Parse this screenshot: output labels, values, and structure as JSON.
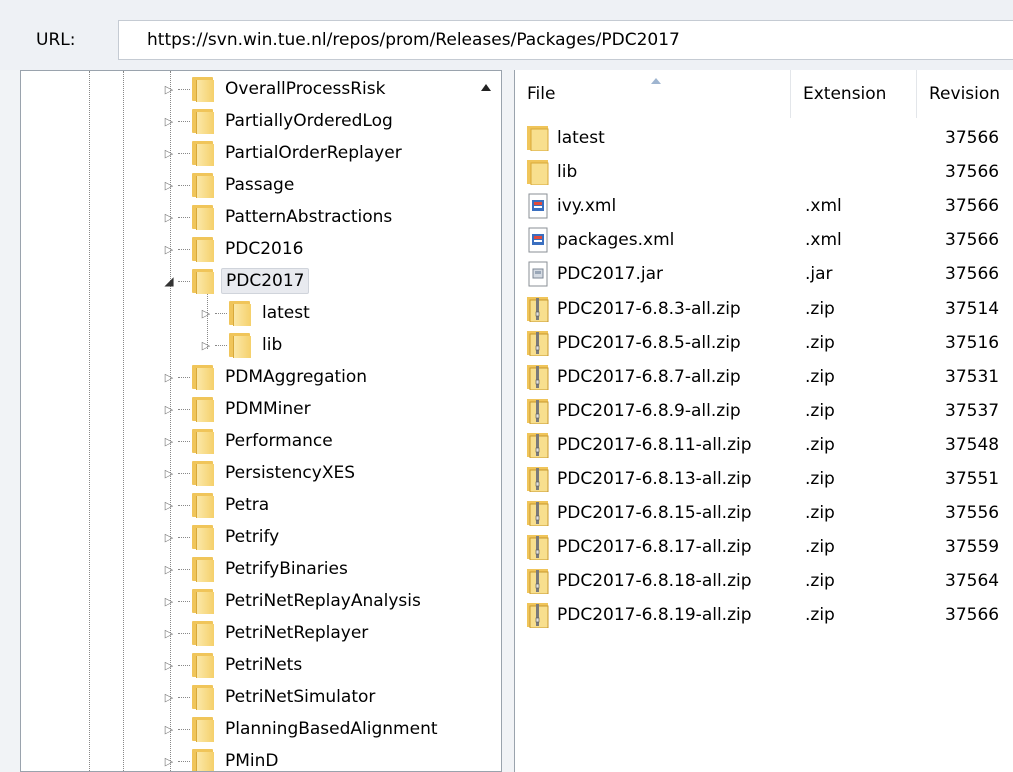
{
  "url_bar": {
    "label": "URL:",
    "value": "https://svn.win.tue.nl/repos/prom/Releases/Packages/PDC2017"
  },
  "tree": {
    "items": [
      {
        "label": "OverallProcessRisk",
        "level": 0,
        "state": "collapsed"
      },
      {
        "label": "PartiallyOrderedLog",
        "level": 0,
        "state": "collapsed"
      },
      {
        "label": "PartialOrderReplayer",
        "level": 0,
        "state": "collapsed"
      },
      {
        "label": "Passage",
        "level": 0,
        "state": "collapsed"
      },
      {
        "label": "PatternAbstractions",
        "level": 0,
        "state": "collapsed"
      },
      {
        "label": "PDC2016",
        "level": 0,
        "state": "collapsed"
      },
      {
        "label": "PDC2017",
        "level": 0,
        "state": "expanded",
        "selected": true
      },
      {
        "label": "latest",
        "level": 1,
        "state": "collapsed"
      },
      {
        "label": "lib",
        "level": 1,
        "state": "collapsed"
      },
      {
        "label": "PDMAggregation",
        "level": 0,
        "state": "collapsed"
      },
      {
        "label": "PDMMiner",
        "level": 0,
        "state": "collapsed"
      },
      {
        "label": "Performance",
        "level": 0,
        "state": "collapsed"
      },
      {
        "label": "PersistencyXES",
        "level": 0,
        "state": "collapsed"
      },
      {
        "label": "Petra",
        "level": 0,
        "state": "collapsed"
      },
      {
        "label": "Petrify",
        "level": 0,
        "state": "collapsed"
      },
      {
        "label": "PetrifyBinaries",
        "level": 0,
        "state": "collapsed"
      },
      {
        "label": "PetriNetReplayAnalysis",
        "level": 0,
        "state": "collapsed"
      },
      {
        "label": "PetriNetReplayer",
        "level": 0,
        "state": "collapsed"
      },
      {
        "label": "PetriNets",
        "level": 0,
        "state": "collapsed"
      },
      {
        "label": "PetriNetSimulator",
        "level": 0,
        "state": "collapsed"
      },
      {
        "label": "PlanningBasedAlignment",
        "level": 0,
        "state": "collapsed"
      },
      {
        "label": "PMinD",
        "level": 0,
        "state": "collapsed"
      }
    ]
  },
  "file_list": {
    "columns": [
      "File",
      "Extension",
      "Revision"
    ],
    "sort_column": "File",
    "rows": [
      {
        "name": "latest",
        "ext": "",
        "rev": "37566",
        "icon": "folder-icon"
      },
      {
        "name": "lib",
        "ext": "",
        "rev": "37566",
        "icon": "folder-icon"
      },
      {
        "name": "ivy.xml",
        "ext": ".xml",
        "rev": "37566",
        "icon": "xml-file-icon"
      },
      {
        "name": "packages.xml",
        "ext": ".xml",
        "rev": "37566",
        "icon": "xml-file-icon"
      },
      {
        "name": "PDC2017.jar",
        "ext": ".jar",
        "rev": "37566",
        "icon": "jar-file-icon"
      },
      {
        "name": "PDC2017-6.8.3-all.zip",
        "ext": ".zip",
        "rev": "37514",
        "icon": "zip-file-icon"
      },
      {
        "name": "PDC2017-6.8.5-all.zip",
        "ext": ".zip",
        "rev": "37516",
        "icon": "zip-file-icon"
      },
      {
        "name": "PDC2017-6.8.7-all.zip",
        "ext": ".zip",
        "rev": "37531",
        "icon": "zip-file-icon"
      },
      {
        "name": "PDC2017-6.8.9-all.zip",
        "ext": ".zip",
        "rev": "37537",
        "icon": "zip-file-icon"
      },
      {
        "name": "PDC2017-6.8.11-all.zip",
        "ext": ".zip",
        "rev": "37548",
        "icon": "zip-file-icon"
      },
      {
        "name": "PDC2017-6.8.13-all.zip",
        "ext": ".zip",
        "rev": "37551",
        "icon": "zip-file-icon"
      },
      {
        "name": "PDC2017-6.8.15-all.zip",
        "ext": ".zip",
        "rev": "37556",
        "icon": "zip-file-icon"
      },
      {
        "name": "PDC2017-6.8.17-all.zip",
        "ext": ".zip",
        "rev": "37559",
        "icon": "zip-file-icon"
      },
      {
        "name": "PDC2017-6.8.18-all.zip",
        "ext": ".zip",
        "rev": "37564",
        "icon": "zip-file-icon"
      },
      {
        "name": "PDC2017-6.8.19-all.zip",
        "ext": ".zip",
        "rev": "37566",
        "icon": "zip-file-icon"
      }
    ]
  }
}
